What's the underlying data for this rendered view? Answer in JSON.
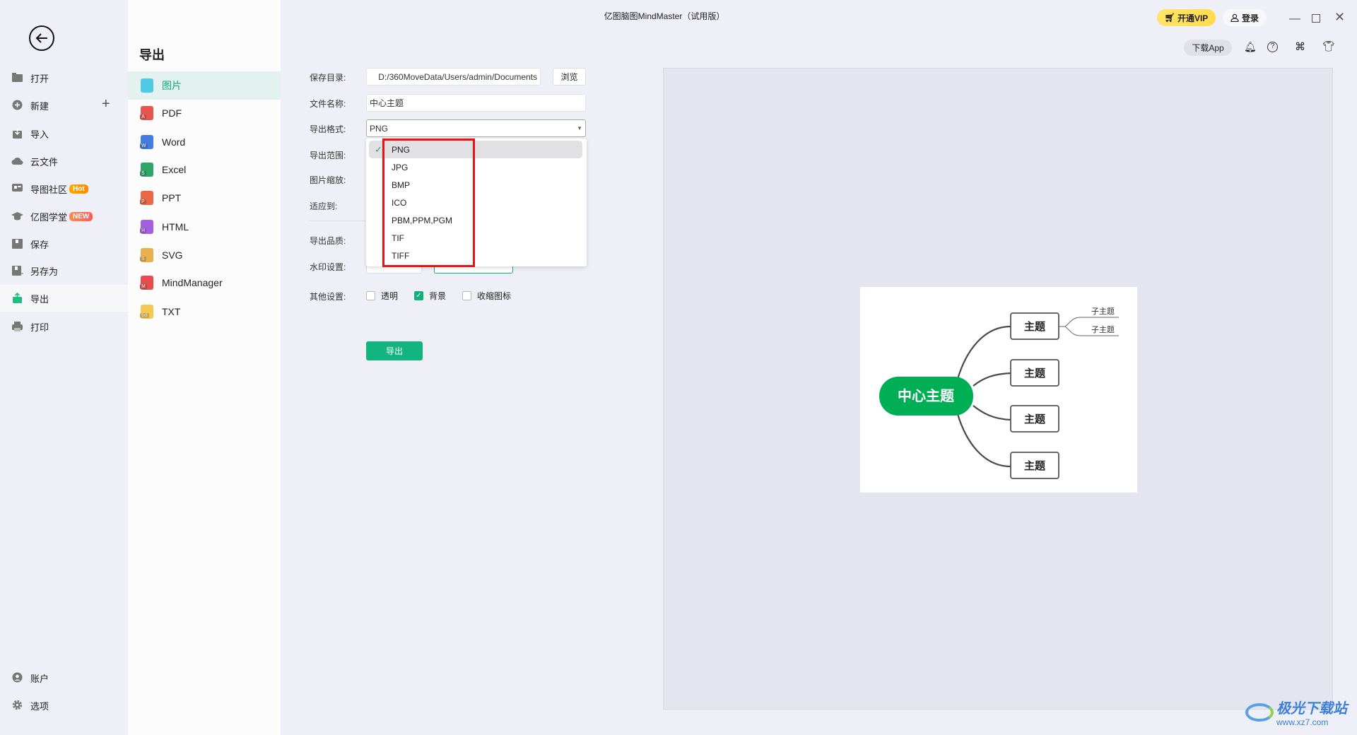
{
  "window": {
    "title": "亿图脑图MindMaster（试用版）",
    "vip_label": "开通VIP",
    "login_label": "登录",
    "download_app_label": "下载App"
  },
  "sidebar": {
    "items": [
      {
        "label": "打开",
        "icon": "folder-icon"
      },
      {
        "label": "新建",
        "icon": "plus-circle-icon"
      },
      {
        "label": "导入",
        "icon": "import-icon"
      },
      {
        "label": "云文件",
        "icon": "cloud-icon"
      },
      {
        "label": "导图社区",
        "icon": "community-icon",
        "badge": "Hot"
      },
      {
        "label": "亿图学堂",
        "icon": "graduation-cap-icon",
        "badge": "NEW"
      },
      {
        "label": "保存",
        "icon": "save-icon"
      },
      {
        "label": "另存为",
        "icon": "save-as-icon"
      },
      {
        "label": "导出",
        "icon": "export-icon",
        "active": true
      },
      {
        "label": "打印",
        "icon": "printer-icon"
      }
    ],
    "bottom": [
      {
        "label": "账户",
        "icon": "user-icon"
      },
      {
        "label": "选项",
        "icon": "gear-icon"
      }
    ]
  },
  "panel": {
    "title": "导出",
    "items": [
      {
        "label": "图片",
        "color": "#3ec6e6",
        "tag": ""
      },
      {
        "label": "PDF",
        "color": "#e2453c",
        "tag": "A"
      },
      {
        "label": "Word",
        "color": "#2f6fe0",
        "tag": "W"
      },
      {
        "label": "Excel",
        "color": "#1a9a5a",
        "tag": "S"
      },
      {
        "label": "PPT",
        "color": "#e8572f",
        "tag": "P"
      },
      {
        "label": "HTML",
        "color": "#9b4fdc",
        "tag": "H"
      },
      {
        "label": "SVG",
        "color": "#e8a83a",
        "tag": "S"
      },
      {
        "label": "MindManager",
        "color": "#e23a3a",
        "tag": "M"
      },
      {
        "label": "TXT",
        "color": "#f5c242",
        "tag": "txt"
      }
    ]
  },
  "form": {
    "save_dir_label": "保存目录:",
    "save_dir_value": "D:/360MoveData/Users/admin/Documents",
    "browse_label": "浏览",
    "filename_label": "文件名称:",
    "filename_value": "中心主题",
    "format_label": "导出格式:",
    "format_value": "PNG",
    "range_label": "导出范围:",
    "scale_label": "图片缩放:",
    "fit_label": "适应到:",
    "quality_label": "导出品质:",
    "watermark_label": "水印设置:",
    "other_label": "其他设置:",
    "options": [
      {
        "label": "透明",
        "checked": false
      },
      {
        "label": "背景",
        "checked": true
      },
      {
        "label": "收缩图标",
        "checked": false
      }
    ],
    "export_label": "导出",
    "format_options": [
      "PNG",
      "JPG",
      "BMP",
      "ICO",
      "PBM,PPM,PGM",
      "TIF",
      "TIFF"
    ],
    "selected_format": "PNG"
  },
  "mindmap": {
    "central": "中心主题",
    "topics": [
      "主题",
      "主题",
      "主题",
      "主题"
    ],
    "subtopics": [
      "子主题",
      "子主题"
    ],
    "central_color": "#00ae56"
  },
  "watermark": {
    "brand": "极光下载站",
    "url": "www.xz7.com"
  },
  "colors": {
    "accent": "#13b07c",
    "highlight_box": "#ee1111",
    "vip": "#ffe35a"
  }
}
